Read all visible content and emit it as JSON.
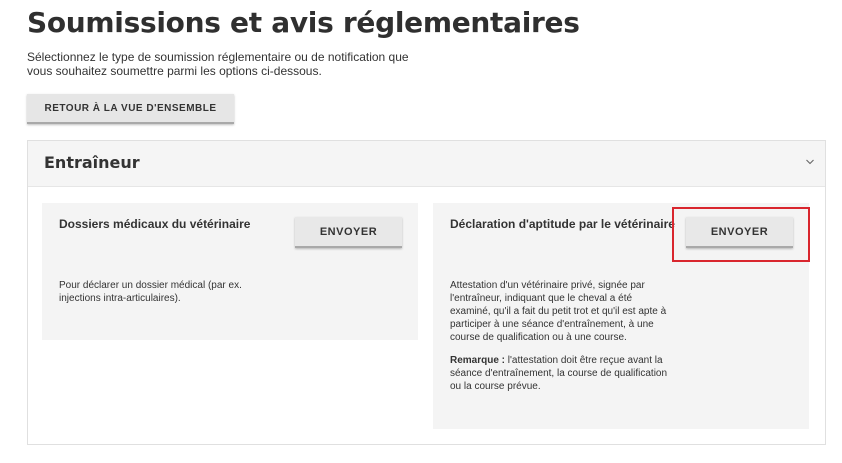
{
  "page": {
    "title": "Soumissions et avis réglementaires",
    "intro": "Sélectionnez le type de soumission réglementaire ou de notification que vous souhaitez soumettre parmi les options ci-dessous.",
    "back_button": "RETOUR À LA VUE D'ENSEMBLE"
  },
  "accordion": {
    "title": "Entraîneur",
    "expanded": true,
    "cards": [
      {
        "title": "Dossiers médicaux du vétérinaire",
        "button": "ENVOYER",
        "description": "Pour déclarer un dossier médical (par ex. injections intra-articulaires)."
      },
      {
        "title": "Déclaration d'aptitude par le vétérinaire",
        "button": "ENVOYER",
        "description": "Attestation d'un vétérinaire privé, signée par l'entraîneur, indiquant que le cheval a été examiné, qu'il a fait du petit trot et qu'il est apte à participer à une séance d'entraînement, à une course de qualification ou à une course.",
        "note_label": "Remarque :",
        "note_text": " l'attestation doit être reçue avant la séance d'entraînement, la course de qualification ou la course prévue."
      }
    ]
  },
  "colors": {
    "highlight": "#d9262e",
    "card_bg": "#f4f4f4",
    "button_bg": "#e8e8e8"
  },
  "icons": {
    "accordion_toggle": "chevron-down-icon"
  }
}
